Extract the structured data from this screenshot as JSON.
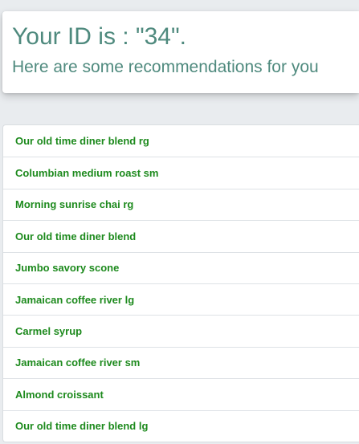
{
  "header": {
    "title": "Your ID is : \"34\".",
    "subtitle": "Here are some recommendations for you"
  },
  "recommendations": [
    {
      "label": "Our old time diner blend rg"
    },
    {
      "label": "Columbian medium roast sm"
    },
    {
      "label": "Morning sunrise chai rg"
    },
    {
      "label": "Our old time diner blend"
    },
    {
      "label": "Jumbo savory scone"
    },
    {
      "label": "Jamaican coffee river lg"
    },
    {
      "label": "Carmel syrup"
    },
    {
      "label": "Jamaican coffee river sm"
    },
    {
      "label": "Almond croissant"
    },
    {
      "label": "Our old time diner blend lg"
    }
  ],
  "colors": {
    "heading": "#4f8a7e",
    "link": "#1d8a1d",
    "background": "#e9ecef"
  }
}
